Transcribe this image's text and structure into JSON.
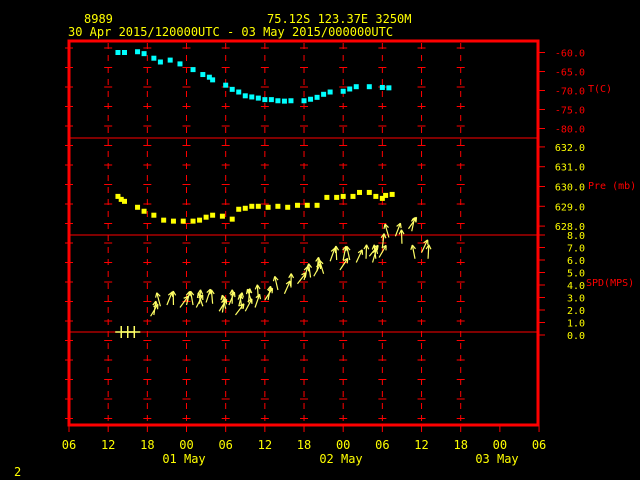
{
  "header": {
    "station_id": "8989",
    "location": "75.12S   123.37E   3250M",
    "time_range": "30 Apr 2015/120000UTC - 03 May 2015/000000UTC"
  },
  "footer": {
    "page_number": "2"
  },
  "colors": {
    "background": "#000000",
    "frame": "#ff0000",
    "grid": "#ff0000",
    "axis_text": "#ffff00",
    "header_text": "#ffff00",
    "panel_label": "#ff0000",
    "temperature": "#00ffff",
    "pressure": "#ffff00",
    "wind": "#ffff66"
  },
  "chart_data": [
    {
      "type": "scatter",
      "panel": "temperature",
      "label": "T(C)",
      "ylim": [
        -82.5,
        -57.5
      ],
      "ticks": [
        -60,
        -65,
        -70,
        -75,
        -80
      ],
      "tick_labels": [
        "-60.0",
        "-65.0",
        "-70.0",
        "-75.0",
        "-80.0"
      ],
      "x_hours": [
        13.5,
        14.5,
        16.5,
        17.5,
        19,
        20,
        21.5,
        23,
        25,
        26.5,
        27.5,
        28,
        30,
        31,
        32,
        33,
        34,
        35,
        36,
        37,
        38,
        39,
        40,
        42,
        43,
        44,
        45,
        46,
        48,
        49,
        50,
        52,
        54,
        55
      ],
      "values": [
        -60.0,
        -60.0,
        -59.8,
        -60.3,
        -61.5,
        -62.5,
        -62.0,
        -63.0,
        -64.5,
        -65.8,
        -66.5,
        -67.2,
        -68.6,
        -69.7,
        -70.4,
        -71.4,
        -71.7,
        -72.0,
        -72.4,
        -72.4,
        -72.7,
        -72.8,
        -72.7,
        -72.7,
        -72.3,
        -71.8,
        -71.0,
        -70.4,
        -70.2,
        -69.6,
        -69.0,
        -69.0,
        -69.2,
        -69.3
      ]
    },
    {
      "type": "scatter",
      "panel": "pressure",
      "label": "Pre (mb)",
      "ylim": [
        627.55,
        632.45
      ],
      "ticks": [
        628,
        629,
        630,
        631,
        632
      ],
      "tick_labels": [
        "628.0",
        "629.0",
        "630.0",
        "631.0",
        "632.0"
      ],
      "x_hours": [
        13.5,
        14,
        14.5,
        16.5,
        17.5,
        19,
        20.5,
        22,
        23.5,
        25,
        26,
        27,
        28,
        29.5,
        31,
        32,
        33,
        34,
        35,
        36.5,
        38,
        39.5,
        41,
        42.5,
        44,
        45.5,
        47,
        48,
        49.5,
        50.5,
        52,
        53,
        54,
        54.5,
        55.5
      ],
      "values": [
        629.5,
        629.35,
        629.25,
        628.95,
        628.75,
        628.55,
        628.3,
        628.25,
        628.25,
        628.25,
        628.3,
        628.45,
        628.55,
        628.5,
        628.35,
        628.85,
        628.9,
        629.0,
        629.0,
        628.95,
        629.0,
        628.95,
        629.05,
        629.05,
        629.05,
        629.45,
        629.45,
        629.5,
        629.5,
        629.7,
        629.7,
        629.5,
        629.4,
        629.55,
        629.6
      ]
    },
    {
      "type": "wind-barbs",
      "panel": "wind_speed",
      "label": "SPD(MPS)",
      "ylim": [
        0,
        8
      ],
      "ticks": [
        0,
        1,
        2,
        3,
        4,
        5,
        6,
        7,
        8
      ],
      "tick_labels": [
        "0.0",
        "1.0",
        "2.0",
        "3.0",
        "4.0",
        "5.0",
        "6.0",
        "7.0",
        "8.0"
      ],
      "x_hours": [
        14,
        15,
        16,
        18.5,
        19,
        20,
        21,
        22,
        23,
        24,
        25,
        25.5,
        26,
        26.5,
        27,
        28,
        29,
        29.5,
        30,
        30.5,
        31,
        31.5,
        32,
        32.5,
        33,
        33.5,
        34,
        34.5,
        35,
        36,
        36.5,
        38,
        39,
        40,
        41,
        42,
        43,
        43.5,
        44,
        45,
        46,
        47,
        47.5,
        48,
        49,
        50,
        51.5,
        52,
        52.5,
        53,
        53.5,
        54,
        55,
        56,
        57,
        58,
        58.5,
        59,
        60,
        61
      ],
      "values": [
        0,
        0,
        0,
        1.5,
        1.6,
        2.3,
        2.4,
        2.4,
        2.2,
        2.4,
        2.4,
        2.2,
        2.5,
        2.3,
        2.6,
        2.5,
        1.9,
        1.8,
        2.1,
        2.4,
        2.5,
        1.6,
        2.3,
        2.1,
        1.9,
        2.6,
        2.6,
        2.2,
        2.9,
        2.8,
        2.8,
        3.6,
        3.3,
        3.8,
        4.1,
        4.4,
        4.6,
        4.7,
        5.1,
        4.9,
        5.9,
        6.0,
        5.2,
        6.0,
        6.0,
        5.8,
        6.1,
        6.3,
        5.8,
        6.1,
        6.2,
        7.0,
        7.8,
        7.9,
        7.3,
        8.5,
        8.3,
        6.1,
        6.6,
        6.1
      ]
    }
  ],
  "x_axis": {
    "hour_ticks": [
      6,
      12,
      18,
      24,
      30,
      36,
      42,
      48,
      54,
      60,
      66
    ],
    "tick_labels": [
      "06",
      "12",
      "18",
      "00",
      "06",
      "12",
      "18",
      "00",
      "06",
      "12",
      "18",
      "00",
      "06"
    ],
    "date_labels": [
      "01 May",
      "02 May",
      "03 May"
    ]
  }
}
